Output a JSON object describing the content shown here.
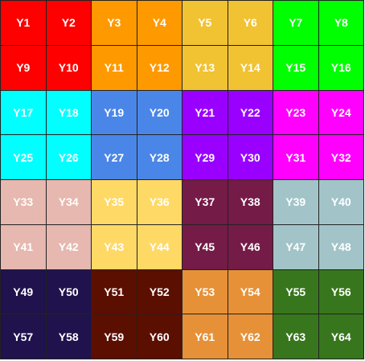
{
  "cells": [
    {
      "label": "Y1",
      "color": "#ff0000"
    },
    {
      "label": "Y2",
      "color": "#ff0000"
    },
    {
      "label": "Y3",
      "color": "#ff9900"
    },
    {
      "label": "Y4",
      "color": "#ff9900"
    },
    {
      "label": "Y5",
      "color": "#f1c232"
    },
    {
      "label": "Y6",
      "color": "#f1c232"
    },
    {
      "label": "Y7",
      "color": "#00ff00"
    },
    {
      "label": "Y8",
      "color": "#00ff00"
    },
    {
      "label": "Y9",
      "color": "#ff0000"
    },
    {
      "label": "Y10",
      "color": "#ff0000"
    },
    {
      "label": "Y11",
      "color": "#ff9900"
    },
    {
      "label": "Y12",
      "color": "#ff9900"
    },
    {
      "label": "Y13",
      "color": "#f1c232"
    },
    {
      "label": "Y14",
      "color": "#f1c232"
    },
    {
      "label": "Y15",
      "color": "#00ff00"
    },
    {
      "label": "Y16",
      "color": "#00ff00"
    },
    {
      "label": "Y17",
      "color": "#00ffff"
    },
    {
      "label": "Y18",
      "color": "#00ffff"
    },
    {
      "label": "Y19",
      "color": "#4a86e8"
    },
    {
      "label": "Y20",
      "color": "#4a86e8"
    },
    {
      "label": "Y21",
      "color": "#9900ff"
    },
    {
      "label": "Y22",
      "color": "#9900ff"
    },
    {
      "label": "Y23",
      "color": "#ff00ff"
    },
    {
      "label": "Y24",
      "color": "#ff00ff"
    },
    {
      "label": "Y25",
      "color": "#00ffff"
    },
    {
      "label": "Y26",
      "color": "#00ffff"
    },
    {
      "label": "Y27",
      "color": "#4a86e8"
    },
    {
      "label": "Y28",
      "color": "#4a86e8"
    },
    {
      "label": "Y29",
      "color": "#9900ff"
    },
    {
      "label": "Y30",
      "color": "#9900ff"
    },
    {
      "label": "Y31",
      "color": "#ff00ff"
    },
    {
      "label": "Y32",
      "color": "#ff00ff"
    },
    {
      "label": "Y33",
      "color": "#e6b8af"
    },
    {
      "label": "Y34",
      "color": "#e6b8af"
    },
    {
      "label": "Y35",
      "color": "#ffd966"
    },
    {
      "label": "Y36",
      "color": "#ffd966"
    },
    {
      "label": "Y37",
      "color": "#741b47"
    },
    {
      "label": "Y38",
      "color": "#741b47"
    },
    {
      "label": "Y39",
      "color": "#a2c4c9"
    },
    {
      "label": "Y40",
      "color": "#a2c4c9"
    },
    {
      "label": "Y41",
      "color": "#e6b8af"
    },
    {
      "label": "Y42",
      "color": "#e6b8af"
    },
    {
      "label": "Y43",
      "color": "#ffd966"
    },
    {
      "label": "Y44",
      "color": "#ffd966"
    },
    {
      "label": "Y45",
      "color": "#741b47"
    },
    {
      "label": "Y46",
      "color": "#741b47"
    },
    {
      "label": "Y47",
      "color": "#a2c4c9"
    },
    {
      "label": "Y48",
      "color": "#a2c4c9"
    },
    {
      "label": "Y49",
      "color": "#20124d"
    },
    {
      "label": "Y50",
      "color": "#20124d"
    },
    {
      "label": "Y51",
      "color": "#5b0f00"
    },
    {
      "label": "Y52",
      "color": "#5b0f00"
    },
    {
      "label": "Y53",
      "color": "#e69138"
    },
    {
      "label": "Y54",
      "color": "#e69138"
    },
    {
      "label": "Y55",
      "color": "#38761d"
    },
    {
      "label": "Y56",
      "color": "#38761d"
    },
    {
      "label": "Y57",
      "color": "#20124d"
    },
    {
      "label": "Y58",
      "color": "#20124d"
    },
    {
      "label": "Y59",
      "color": "#5b0f00"
    },
    {
      "label": "Y60",
      "color": "#5b0f00"
    },
    {
      "label": "Y61",
      "color": "#e69138"
    },
    {
      "label": "Y62",
      "color": "#e69138"
    },
    {
      "label": "Y63",
      "color": "#38761d"
    },
    {
      "label": "Y64",
      "color": "#38761d"
    }
  ]
}
